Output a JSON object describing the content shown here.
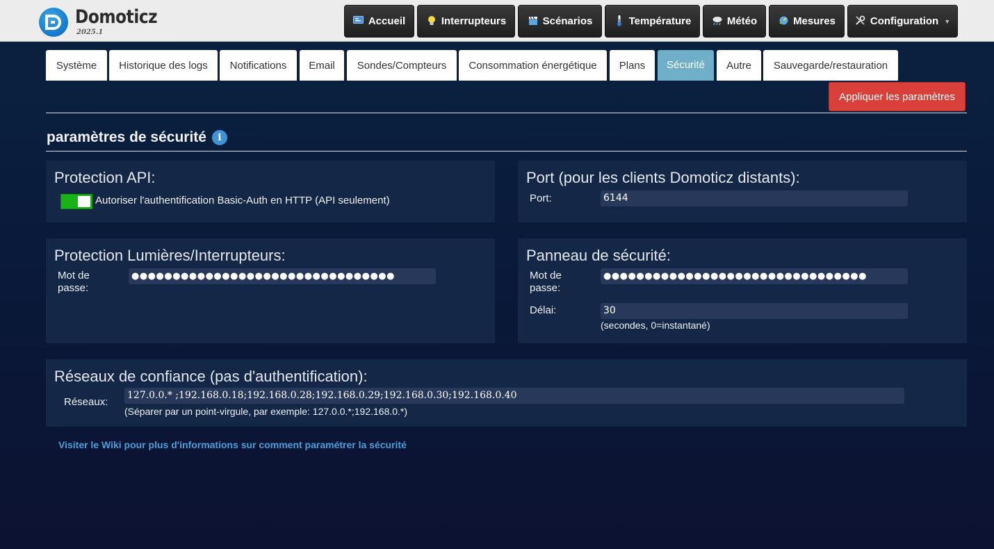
{
  "app": {
    "name": "Domoticz",
    "version": "2025.1"
  },
  "nav": {
    "accueil": "Accueil",
    "interrupteurs": "Interrupteurs",
    "scenarios": "Scénarios",
    "temperature": "Température",
    "meteo": "Météo",
    "mesures": "Mesures",
    "configuration": "Configuration"
  },
  "tabs": {
    "systeme": "Système",
    "logs": "Historique des logs",
    "notifications": "Notifications",
    "email": "Email",
    "sondes": "Sondes/Compteurs",
    "energie": "Consommation énergétique",
    "plans": "Plans",
    "securite": "Sécurité",
    "autre": "Autre",
    "sauvegarde": "Sauvegarde/restauration",
    "active": "Sécurité"
  },
  "apply_button": "Appliquer les paramètres",
  "section_title": "paramètres de sécurité",
  "api_protection": {
    "title": "Protection API:",
    "toggle_label": "Autoriser l'authentification Basic-Auth en HTTP (API seulement)",
    "toggle_on": true
  },
  "port_panel": {
    "title": "Port (pour les clients Domoticz distants):",
    "port_label": "Port:",
    "port_value": "6144"
  },
  "lights_protection": {
    "title": "Protection Lumières/Interrupteurs:",
    "password_label_1": "Mot de",
    "password_label_2": "passe:",
    "password_value": "●●●●●●●●●●●●●●●●●●●●●●●●●●●●●●●●"
  },
  "security_panel": {
    "title": "Panneau de sécurité:",
    "password_label_1": "Mot de",
    "password_label_2": "passe:",
    "password_value": "●●●●●●●●●●●●●●●●●●●●●●●●●●●●●●●●",
    "delay_label": "Délai:",
    "delay_value": "30",
    "delay_hint": "(secondes, 0=instantané)"
  },
  "trusted_networks": {
    "title": "Réseaux de confiance (pas d'authentification):",
    "networks_label": "Réseaux:",
    "networks_value": "127.0.0.* ;192.168.0.18;192.168.0.28;192.168.0.29;192.168.0.30;192.168.0.40",
    "hint": "(Séparer par un point-virgule, par exemple: 127.0.0.*;192.168.0.*)"
  },
  "wiki_link": "Visiter le Wiki pour plus d'informations sur comment paramétrer la sécurité",
  "colors": {
    "toggle_on": "#17b317",
    "apply_button": "#d9403a",
    "active_tab": "#6fb0c8",
    "link": "#4a9fd8"
  },
  "icons": {
    "accueil": "monitor-icon",
    "interrupteurs": "lightbulb-icon",
    "scenarios": "clapperboard-icon",
    "temperature": "thermometer-icon",
    "meteo": "cloud-rain-icon",
    "mesures": "gauge-icon",
    "configuration": "tools-icon"
  }
}
